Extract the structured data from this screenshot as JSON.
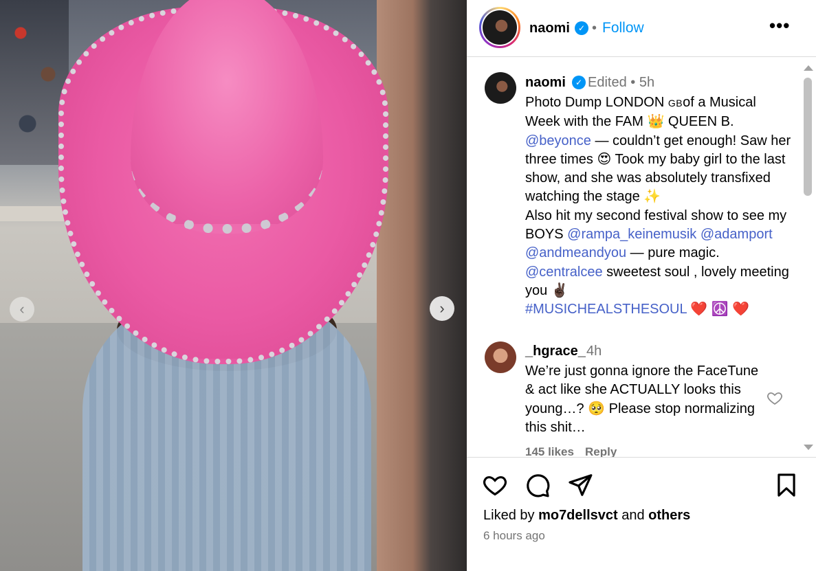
{
  "post": {
    "username": "naomi",
    "follow_label": "Follow",
    "separator": "•",
    "more_label": "•••"
  },
  "caption": {
    "username": "naomi",
    "meta": "Edited • 5h",
    "line1": "Photo Dump  LONDON ",
    "line1_small": "GB",
    "line1_rest": "of a Musical Week with the FAM 👑 QUEEN B.",
    "mention_beyonce": "@beyonce",
    "line2": " — couldn’t get enough! Saw her three times 😍 Took my baby girl to the last show, and she was absolutely transfixed watching the stage ✨",
    "line3": "Also hit my second festival show to see my BOYS ",
    "mention_rampa": "@rampa_keinemusik",
    "mention_adamport": "@adamport",
    "mention_andme": "@andmeandyou",
    "line4": " — pure magic. ",
    "mention_centralcee": "@centralcee",
    "line5": " sweetest  soul , lovely meeting you ✌🏿",
    "hashtag": "#MUSICHEALSTHESOUL",
    "hashtag_emoji": " ❤️ ☮️ ❤️"
  },
  "comment": {
    "username": "_hgrace_",
    "time": "4h",
    "text": "We’re just gonna ignore the FaceTune & act like she ACTUALLY looks this young…? 🥺 Please stop normalizing this shit…",
    "likes": "145 likes",
    "reply_label": "Reply"
  },
  "footer": {
    "liked_prefix": "Liked by ",
    "liked_user": "mo7dellsvct",
    "liked_and": " and ",
    "liked_others": "others",
    "time_ago": "6 hours ago"
  },
  "nav": {
    "prev_glyph": "‹",
    "next_glyph": "›"
  },
  "colors": {
    "link": "#4661c8",
    "follow": "#0095f6",
    "secondary_text": "#737373",
    "hat_pink": "#ea5aa4"
  }
}
